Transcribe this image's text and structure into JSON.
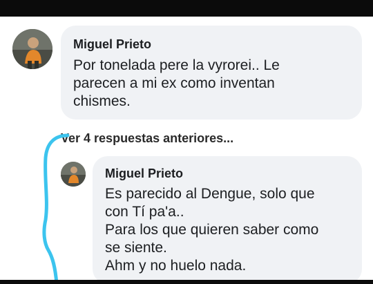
{
  "comment": {
    "author": "Miguel Prieto",
    "lines": [
      "Por tonelada pere la vyrorei.. Le",
      "parecen a mi ex como inventan",
      "chismes."
    ]
  },
  "view_previous_replies": "Ver 4 respuestas anteriores...",
  "reply": {
    "author": "Miguel Prieto",
    "lines": [
      "Es parecido al Dengue, solo que",
      "con Tí pa'a..",
      "Para los que quieren saber como",
      "se siente.",
      "Ahm y no huelo nada."
    ]
  },
  "colors": {
    "bubble": "#f0f2f5",
    "annotation_stroke": "#3cc4ee",
    "frame": "#0b0b0b"
  }
}
